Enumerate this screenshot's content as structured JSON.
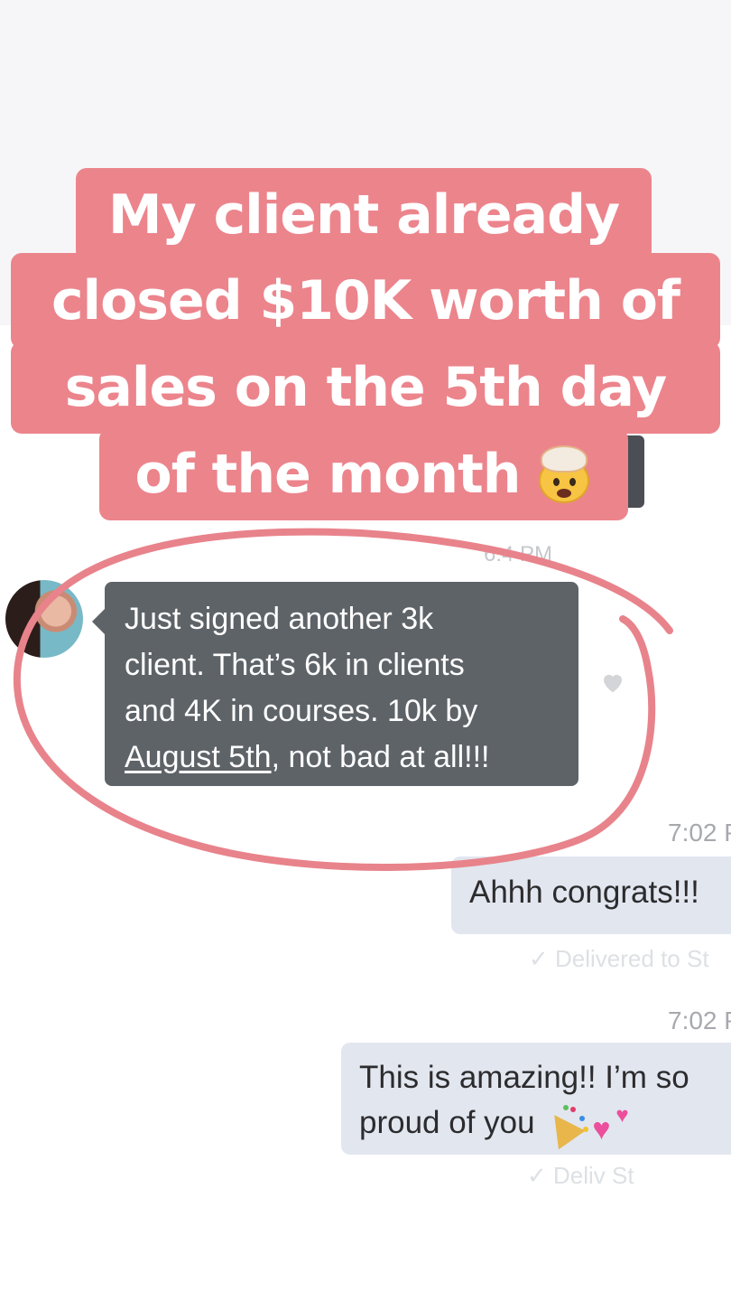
{
  "caption": {
    "line1": "My client already",
    "line2": "closed $10K worth of",
    "line3": "sales on the 5th day",
    "line4": "of the month"
  },
  "chat": {
    "faded_time": "6:4 PM",
    "incoming": {
      "line1": "Just signed another 3k",
      "line2": "client. That’s 6k in clients",
      "line3": "and 4K in courses. 10k by",
      "date_link": "August 5th",
      "line4_rest": ", not bad at all!!!"
    },
    "outgoing": [
      {
        "time": "7:02 P",
        "text": "Ahhh congrats!!!",
        "status": "Delivered to St"
      },
      {
        "time": "7:02 P",
        "line1": "This is amazing!! I’m so",
        "line2": "proud of you",
        "status": "Deliv St"
      }
    ]
  },
  "colors": {
    "caption_bg": "#ec848c",
    "incoming_bubble": "#5e6368",
    "outgoing_bubble": "#e2e6ef",
    "circle_stroke": "#e8838b"
  },
  "icons": [
    "mind-blown-emoji",
    "heart-icon",
    "party-popper-emoji",
    "two-hearts-emoji",
    "checkmark-icon"
  ]
}
